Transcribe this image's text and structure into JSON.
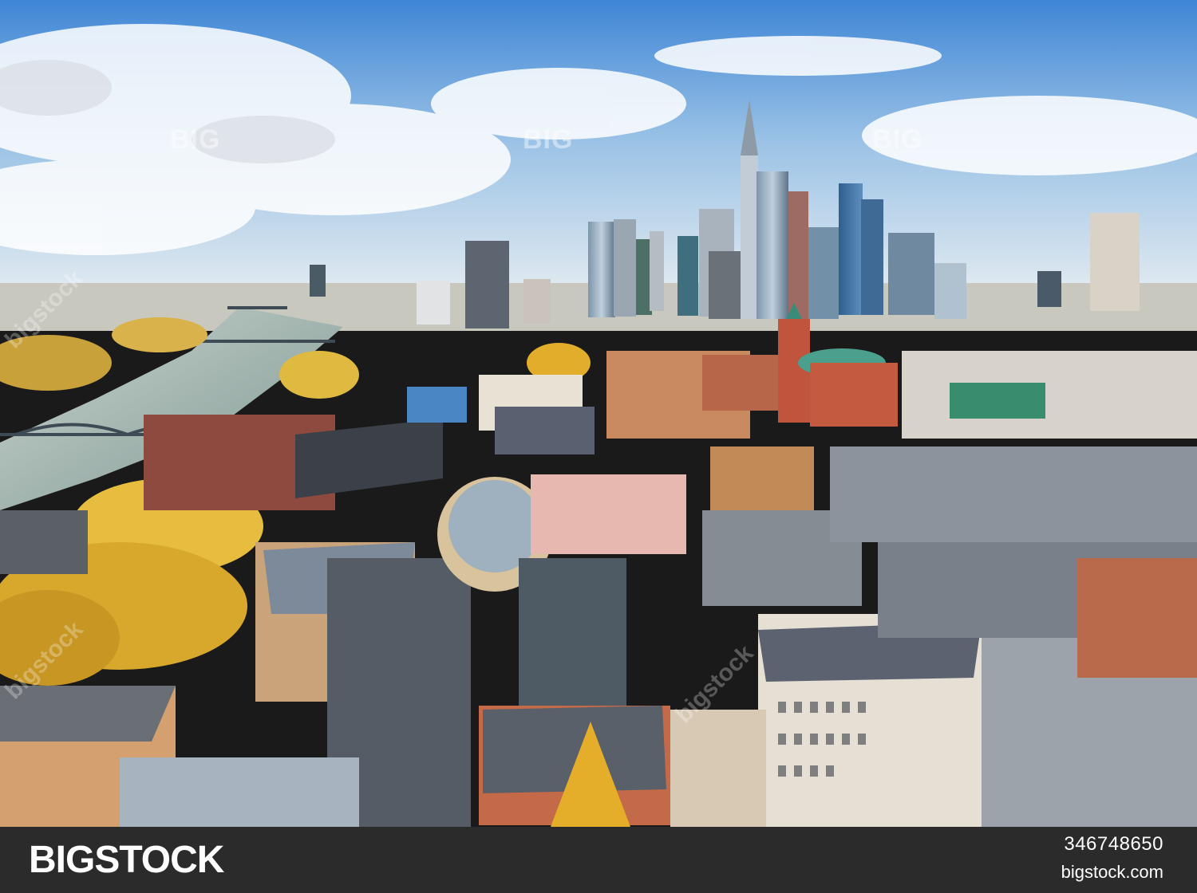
{
  "photo": {
    "subject": "Frankfurt skyline aerial view with old town, river and bridges",
    "colors": {
      "sky_top": "#3f86d6",
      "sky_low": "#e9eef2",
      "river": "#8aa3a0",
      "foliage": "#e2b23a",
      "roof": "#6f7480",
      "brick": "#c0543c"
    }
  },
  "watermarks": {
    "big_1": "BIG",
    "big_2": "BIG",
    "big_3": "BIG",
    "diag_1": "bigstock",
    "diag_2": "bigstock",
    "diag_3": "bigstock"
  },
  "footer": {
    "brand": "BIGSTOCK",
    "image_id": "346748650",
    "site": "bigstock.com"
  }
}
